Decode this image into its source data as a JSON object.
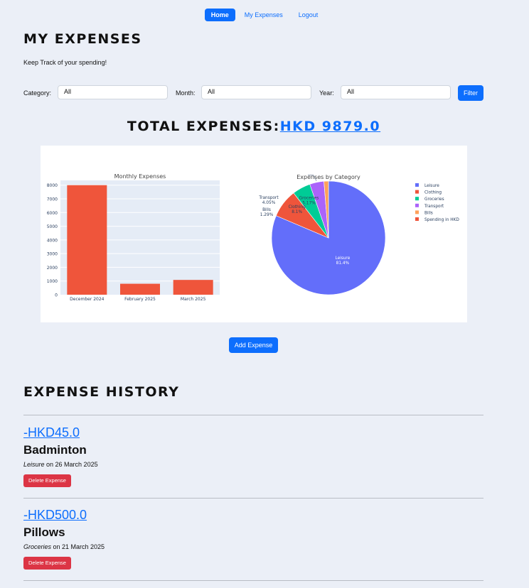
{
  "nav": {
    "home": "Home",
    "expenses": "My Expenses",
    "logout": "Logout"
  },
  "page": {
    "title": "MY EXPENSES",
    "subtitle": "Keep Track of your spending!"
  },
  "filters": {
    "category_label": "Category:",
    "category_value": "All",
    "month_label": "Month:",
    "month_value": "All",
    "year_label": "Year:",
    "year_value": "All",
    "button": "Filter"
  },
  "total": {
    "label": "TOTAL EXPENSES:",
    "amount": "HKD 9879.0"
  },
  "add_button": "Add Expense",
  "history": {
    "title": "EXPENSE HISTORY",
    "items": [
      {
        "amount": "-HKD45.0",
        "title": "Badminton",
        "category": "Leisure",
        "date_text": " on 26 March 2025",
        "delete": "Delete Expense"
      },
      {
        "amount": "-HKD500.0",
        "title": "Pillows",
        "category": "Groceries",
        "date_text": " on 21 March 2025",
        "delete": "Delete Expense"
      }
    ]
  },
  "colors": {
    "accent": "#0d6efd",
    "danger": "#dc3545",
    "bar": "#ef553b"
  },
  "chart_data": [
    {
      "type": "bar",
      "title": "Monthly Expenses",
      "categories": [
        "December 2024",
        "February 2025",
        "March 2025"
      ],
      "values": [
        8000,
        800,
        1080
      ],
      "ylim": [
        0,
        8350
      ],
      "yticks": [
        0,
        1000,
        2000,
        3000,
        4000,
        5000,
        6000,
        7000,
        8000
      ],
      "color": "#ef553b",
      "grid": true
    },
    {
      "type": "pie",
      "title": "Expenses by Category",
      "legend_position": "right",
      "slices": [
        {
          "name": "Leisure",
          "value": 81.4,
          "label": "Leisure",
          "pct": "81.4%",
          "color": "#636efa"
        },
        {
          "name": "Clothing",
          "value": 8.1,
          "label": "Clothing",
          "pct": "8.1%",
          "color": "#ef553b"
        },
        {
          "name": "Groceries",
          "value": 5.17,
          "label": "Groceries",
          "pct": "5.17%",
          "color": "#00cc96"
        },
        {
          "name": "Transport",
          "value": 4.05,
          "label": "Transport",
          "pct": "4.05%",
          "color": "#ab63fa"
        },
        {
          "name": "Bills",
          "value": 1.29,
          "label": "Bills",
          "pct": "1.29%",
          "color": "#ffa15a"
        },
        {
          "name": "Spending in HKD",
          "value": 0,
          "label": "",
          "pct": "",
          "color": "#ef553b"
        }
      ]
    }
  ]
}
